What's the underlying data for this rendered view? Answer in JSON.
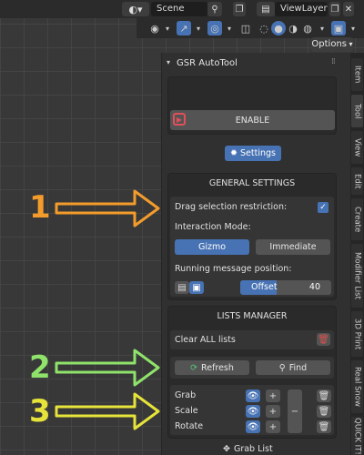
{
  "header": {
    "scene_label": "Scene",
    "viewlayer_label": "ViewLayer",
    "options_label": "Options"
  },
  "panel": {
    "title": "GSR AutoTool",
    "enable_label": "ENABLE",
    "settings_label": "Settings"
  },
  "general": {
    "title": "GENERAL SETTINGS",
    "drag_label": "Drag selection restriction:",
    "drag_checked": true,
    "interaction_label": "Interaction Mode:",
    "mode_gizmo": "Gizmo",
    "mode_immediate": "Immediate",
    "running_label": "Running message position:",
    "offset_label": "Offset",
    "offset_value": "40"
  },
  "lists": {
    "title": "LISTS MANAGER",
    "clear_label": "Clear ALL lists",
    "refresh_label": "Refresh",
    "find_label": "Find",
    "items": [
      "Grab",
      "Scale",
      "Rotate"
    ],
    "grab_list_label": "Grab List"
  },
  "tabs": [
    "Item",
    "Tool",
    "View",
    "Edit",
    "Create",
    "Modifier List",
    "3D Print",
    "Real Snow",
    "QUICK IT!"
  ],
  "annotations": [
    "1",
    "2",
    "3"
  ],
  "colors": {
    "accent": "#4772b3",
    "arrow1": "#f39c2b",
    "arrow2": "#8fe36b",
    "arrow3": "#e6e33a",
    "enable_icon": "#e0505a",
    "trash_icon": "#d9534f"
  }
}
